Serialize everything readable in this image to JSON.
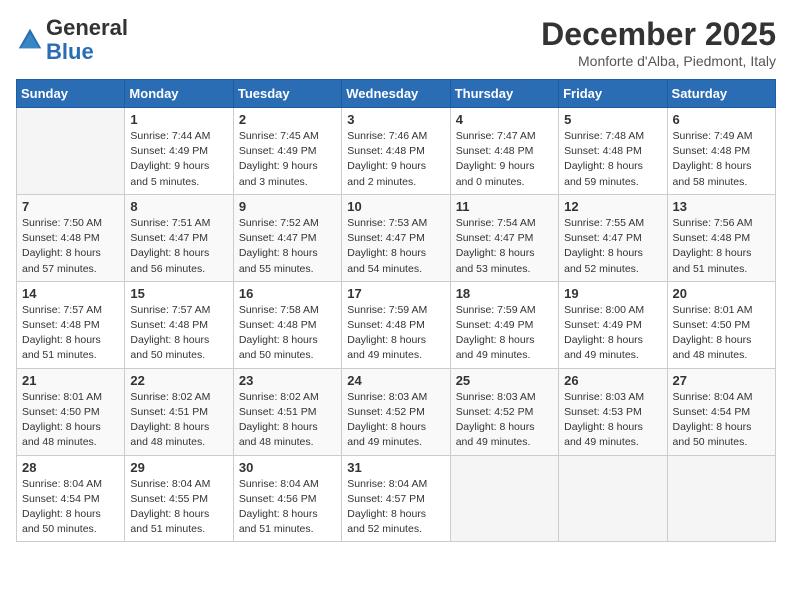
{
  "header": {
    "logo_general": "General",
    "logo_blue": "Blue",
    "month_title": "December 2025",
    "location": "Monforte d'Alba, Piedmont, Italy"
  },
  "days_of_week": [
    "Sunday",
    "Monday",
    "Tuesday",
    "Wednesday",
    "Thursday",
    "Friday",
    "Saturday"
  ],
  "weeks": [
    [
      {
        "day": "",
        "info": ""
      },
      {
        "day": "1",
        "info": "Sunrise: 7:44 AM\nSunset: 4:49 PM\nDaylight: 9 hours\nand 5 minutes."
      },
      {
        "day": "2",
        "info": "Sunrise: 7:45 AM\nSunset: 4:49 PM\nDaylight: 9 hours\nand 3 minutes."
      },
      {
        "day": "3",
        "info": "Sunrise: 7:46 AM\nSunset: 4:48 PM\nDaylight: 9 hours\nand 2 minutes."
      },
      {
        "day": "4",
        "info": "Sunrise: 7:47 AM\nSunset: 4:48 PM\nDaylight: 9 hours\nand 0 minutes."
      },
      {
        "day": "5",
        "info": "Sunrise: 7:48 AM\nSunset: 4:48 PM\nDaylight: 8 hours\nand 59 minutes."
      },
      {
        "day": "6",
        "info": "Sunrise: 7:49 AM\nSunset: 4:48 PM\nDaylight: 8 hours\nand 58 minutes."
      }
    ],
    [
      {
        "day": "7",
        "info": "Sunrise: 7:50 AM\nSunset: 4:48 PM\nDaylight: 8 hours\nand 57 minutes."
      },
      {
        "day": "8",
        "info": "Sunrise: 7:51 AM\nSunset: 4:47 PM\nDaylight: 8 hours\nand 56 minutes."
      },
      {
        "day": "9",
        "info": "Sunrise: 7:52 AM\nSunset: 4:47 PM\nDaylight: 8 hours\nand 55 minutes."
      },
      {
        "day": "10",
        "info": "Sunrise: 7:53 AM\nSunset: 4:47 PM\nDaylight: 8 hours\nand 54 minutes."
      },
      {
        "day": "11",
        "info": "Sunrise: 7:54 AM\nSunset: 4:47 PM\nDaylight: 8 hours\nand 53 minutes."
      },
      {
        "day": "12",
        "info": "Sunrise: 7:55 AM\nSunset: 4:47 PM\nDaylight: 8 hours\nand 52 minutes."
      },
      {
        "day": "13",
        "info": "Sunrise: 7:56 AM\nSunset: 4:48 PM\nDaylight: 8 hours\nand 51 minutes."
      }
    ],
    [
      {
        "day": "14",
        "info": "Sunrise: 7:57 AM\nSunset: 4:48 PM\nDaylight: 8 hours\nand 51 minutes."
      },
      {
        "day": "15",
        "info": "Sunrise: 7:57 AM\nSunset: 4:48 PM\nDaylight: 8 hours\nand 50 minutes."
      },
      {
        "day": "16",
        "info": "Sunrise: 7:58 AM\nSunset: 4:48 PM\nDaylight: 8 hours\nand 50 minutes."
      },
      {
        "day": "17",
        "info": "Sunrise: 7:59 AM\nSunset: 4:48 PM\nDaylight: 8 hours\nand 49 minutes."
      },
      {
        "day": "18",
        "info": "Sunrise: 7:59 AM\nSunset: 4:49 PM\nDaylight: 8 hours\nand 49 minutes."
      },
      {
        "day": "19",
        "info": "Sunrise: 8:00 AM\nSunset: 4:49 PM\nDaylight: 8 hours\nand 49 minutes."
      },
      {
        "day": "20",
        "info": "Sunrise: 8:01 AM\nSunset: 4:50 PM\nDaylight: 8 hours\nand 48 minutes."
      }
    ],
    [
      {
        "day": "21",
        "info": "Sunrise: 8:01 AM\nSunset: 4:50 PM\nDaylight: 8 hours\nand 48 minutes."
      },
      {
        "day": "22",
        "info": "Sunrise: 8:02 AM\nSunset: 4:51 PM\nDaylight: 8 hours\nand 48 minutes."
      },
      {
        "day": "23",
        "info": "Sunrise: 8:02 AM\nSunset: 4:51 PM\nDaylight: 8 hours\nand 48 minutes."
      },
      {
        "day": "24",
        "info": "Sunrise: 8:03 AM\nSunset: 4:52 PM\nDaylight: 8 hours\nand 49 minutes."
      },
      {
        "day": "25",
        "info": "Sunrise: 8:03 AM\nSunset: 4:52 PM\nDaylight: 8 hours\nand 49 minutes."
      },
      {
        "day": "26",
        "info": "Sunrise: 8:03 AM\nSunset: 4:53 PM\nDaylight: 8 hours\nand 49 minutes."
      },
      {
        "day": "27",
        "info": "Sunrise: 8:04 AM\nSunset: 4:54 PM\nDaylight: 8 hours\nand 50 minutes."
      }
    ],
    [
      {
        "day": "28",
        "info": "Sunrise: 8:04 AM\nSunset: 4:54 PM\nDaylight: 8 hours\nand 50 minutes."
      },
      {
        "day": "29",
        "info": "Sunrise: 8:04 AM\nSunset: 4:55 PM\nDaylight: 8 hours\nand 51 minutes."
      },
      {
        "day": "30",
        "info": "Sunrise: 8:04 AM\nSunset: 4:56 PM\nDaylight: 8 hours\nand 51 minutes."
      },
      {
        "day": "31",
        "info": "Sunrise: 8:04 AM\nSunset: 4:57 PM\nDaylight: 8 hours\nand 52 minutes."
      },
      {
        "day": "",
        "info": ""
      },
      {
        "day": "",
        "info": ""
      },
      {
        "day": "",
        "info": ""
      }
    ]
  ]
}
